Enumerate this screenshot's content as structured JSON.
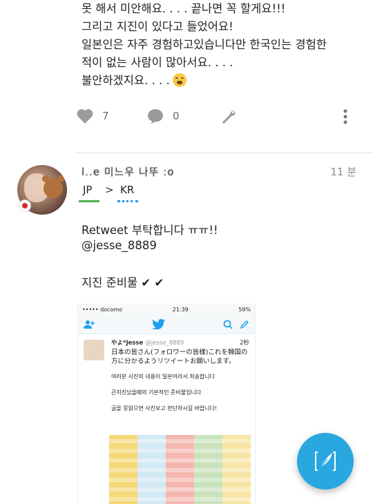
{
  "previous_tweet": {
    "lines": [
      "못 해서 미안해요. . . . 끝나면 꼭 할게요!!!",
      "그리고 지진이 있다고 들었어요!",
      "일본인은 자주 경험하고있습니다만 한국인는 경험한",
      "적이 없는 사람이 많아서요. . . .",
      "불안하겠지요. . . ."
    ],
    "likes": "7",
    "replies": "0"
  },
  "tweet": {
    "username": "l..e 미느우 나뚜 :o",
    "time": "11 분",
    "lang_from": "JP",
    "lang_arrow": ">",
    "lang_to": "KR",
    "text_line1": "Retweet 부탁합니다 ㅠㅠ!!",
    "text_line2": "@jesse_8889",
    "text_line3": "지진 준비물 ✔ ✔"
  },
  "embedded_screenshot": {
    "carrier": "••••• docomo",
    "clock": "21:39",
    "battery": "59%",
    "name": "やよ*Jesse",
    "handle": "@jesse_8889",
    "age": "2秒",
    "jp_text": "日本の皆さん(フォロワーの皆様)これを韓国の方に分かるようリツイートお願いします。",
    "kr_lines": [
      "여러분 사진의 내용이 일본어라서 죄송합니다",
      "큰지진났을때의 기본적인 준비물입니다",
      "글을 못읽으면 사진보고 판단하시길 바랍니다!"
    ]
  },
  "colors": {
    "accent": "#29a8e0",
    "lang_from_underline": "#4caf50",
    "lang_to_underline": "#2196f3",
    "flag_red": "#d62b2b"
  },
  "icons": [
    "heart-icon",
    "reply-icon",
    "wrench-icon",
    "more-vertical-icon",
    "compose-feather-icon",
    "japan-flag-icon",
    "twitter-bird-icon",
    "add-user-icon",
    "search-icon",
    "compose-icon"
  ]
}
